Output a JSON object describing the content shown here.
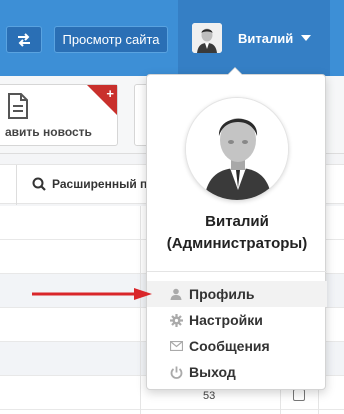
{
  "topbar": {
    "switch_icon": "swap-arrows-icon",
    "site_button": "Просмотр сайта",
    "user_name": "Виталий"
  },
  "toolbar": {
    "add_news_label": "авить новость"
  },
  "search": {
    "advanced_label": "Расширенный п"
  },
  "table": {
    "visible_cell": "53"
  },
  "dropdown": {
    "name_line1": "Виталий",
    "name_line2": "(Администраторы)",
    "items": [
      {
        "label": "Профиль",
        "icon": "user-icon"
      },
      {
        "label": "Настройки",
        "icon": "gear-icon"
      },
      {
        "label": "Сообщения",
        "icon": "envelope-icon"
      },
      {
        "label": "Выход",
        "icon": "power-icon"
      }
    ]
  },
  "colors": {
    "topbar": "#3d8fd6",
    "topbar_user_area": "#357fc5",
    "arrow": "#d9262a"
  }
}
